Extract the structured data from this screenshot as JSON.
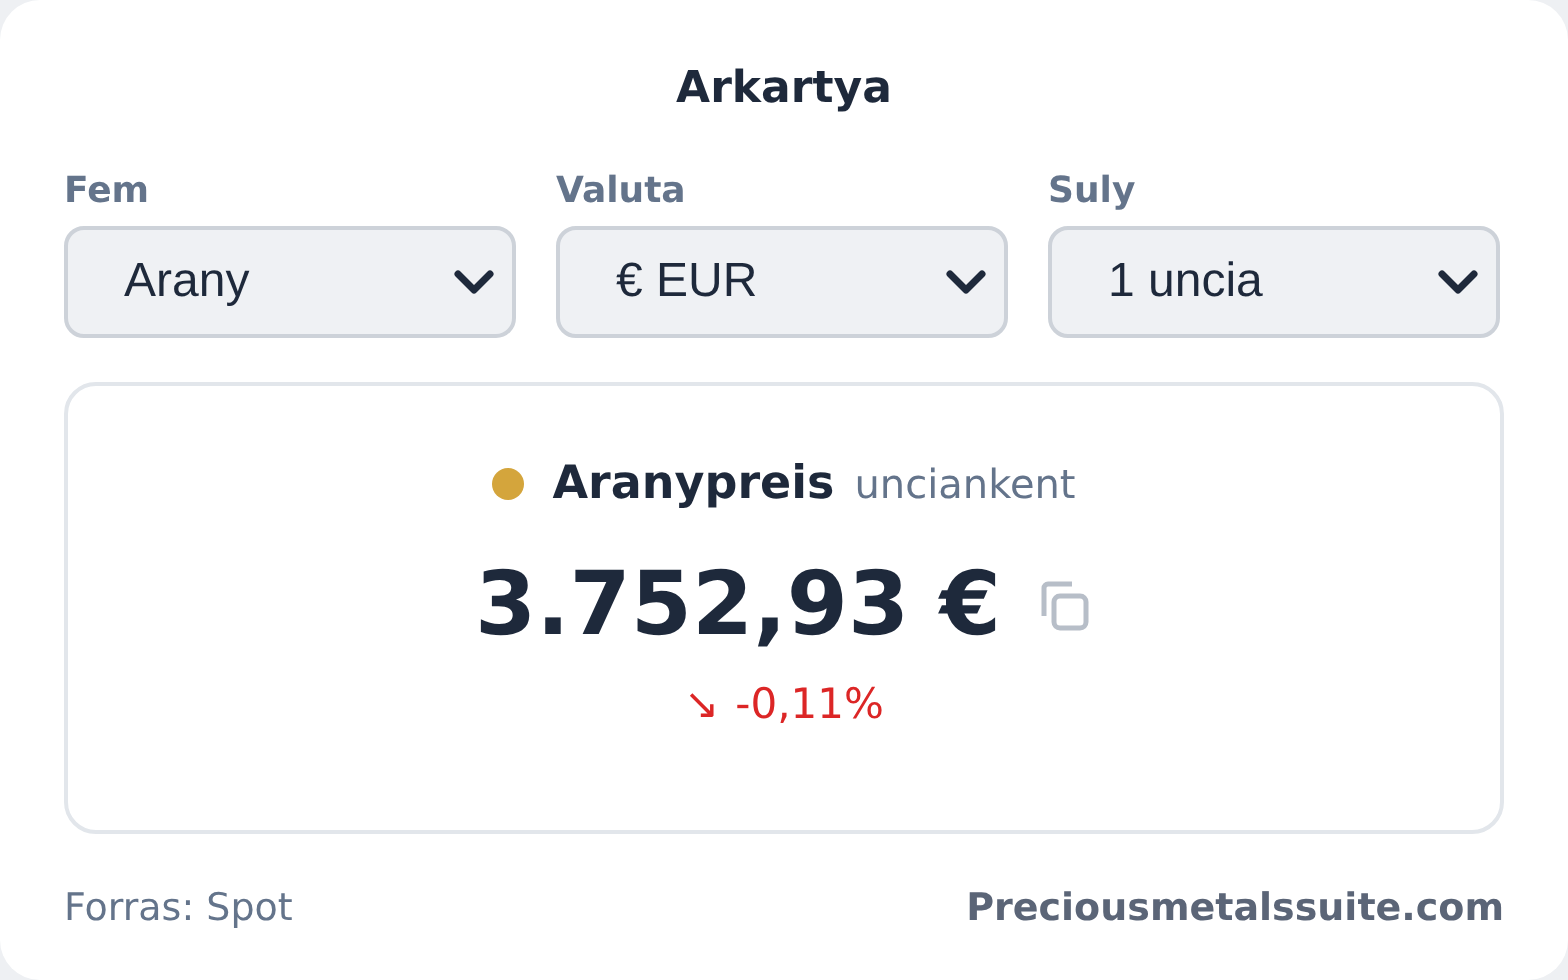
{
  "title": "Arkartya",
  "selectors": [
    {
      "label": "Fem",
      "value": "Arany"
    },
    {
      "label": "Valuta",
      "value": "€ EUR"
    },
    {
      "label": "Suly",
      "value": "1 uncia"
    }
  ],
  "price": {
    "name": "Aranypreis",
    "unit": "unciankent",
    "color": "#d4a53c",
    "value": "3.752,93 €",
    "change": {
      "arrow": "↘",
      "value": "-0,11%",
      "falling": true
    }
  },
  "footer": {
    "source": "Forras: Spot",
    "site": "Preciousmetalssuite.com"
  }
}
